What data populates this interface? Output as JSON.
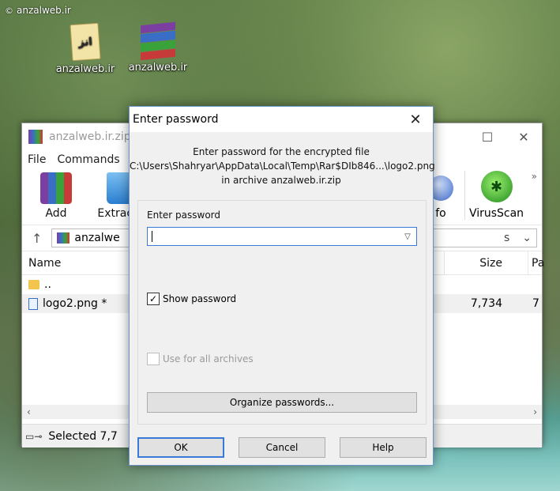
{
  "watermark": {
    "text": "anzalweb.ir"
  },
  "desktop": {
    "icons": [
      {
        "label": "anzalweb.ir",
        "glyph": "انز"
      },
      {
        "label": "anzalweb.ir"
      }
    ]
  },
  "winrar": {
    "title": "anzalweb.ir.zip",
    "menu": [
      "File",
      "Commands"
    ],
    "toolbar": {
      "add": "Add",
      "extract": "Extract T",
      "info": "fo",
      "virus": "VirusScan",
      "more": "»"
    },
    "address": {
      "path": "anzalwe",
      "right_text": "s"
    },
    "columns": {
      "name": "Name",
      "size": "Size",
      "pa": "Pa"
    },
    "rows": [
      {
        "name": "..",
        "size": "",
        "pa": ""
      },
      {
        "name": "logo2.png *",
        "size": "7,734",
        "pa": "7"
      }
    ],
    "status": "Selected 7,7"
  },
  "dialog": {
    "title": "Enter password",
    "message_line1": "Enter password for the encrypted file",
    "message_line2": "C:\\Users\\Shahryar\\AppData\\Local\\Temp\\Rar$DIb846...\\logo2.png",
    "message_line3": "in archive anzalweb.ir.zip",
    "password_label": "Enter password",
    "password_value": "",
    "show_password_label": "Show password",
    "show_password_checked": true,
    "use_all_archives_label": "Use for all archives",
    "use_all_archives_checked": false,
    "organize_button": "Organize passwords...",
    "ok": "OK",
    "cancel": "Cancel",
    "help": "Help"
  },
  "colors": {
    "accent": "#3a7ad6",
    "dialog_bg": "#f0f0f0",
    "button_bg": "#e1e1e1"
  }
}
